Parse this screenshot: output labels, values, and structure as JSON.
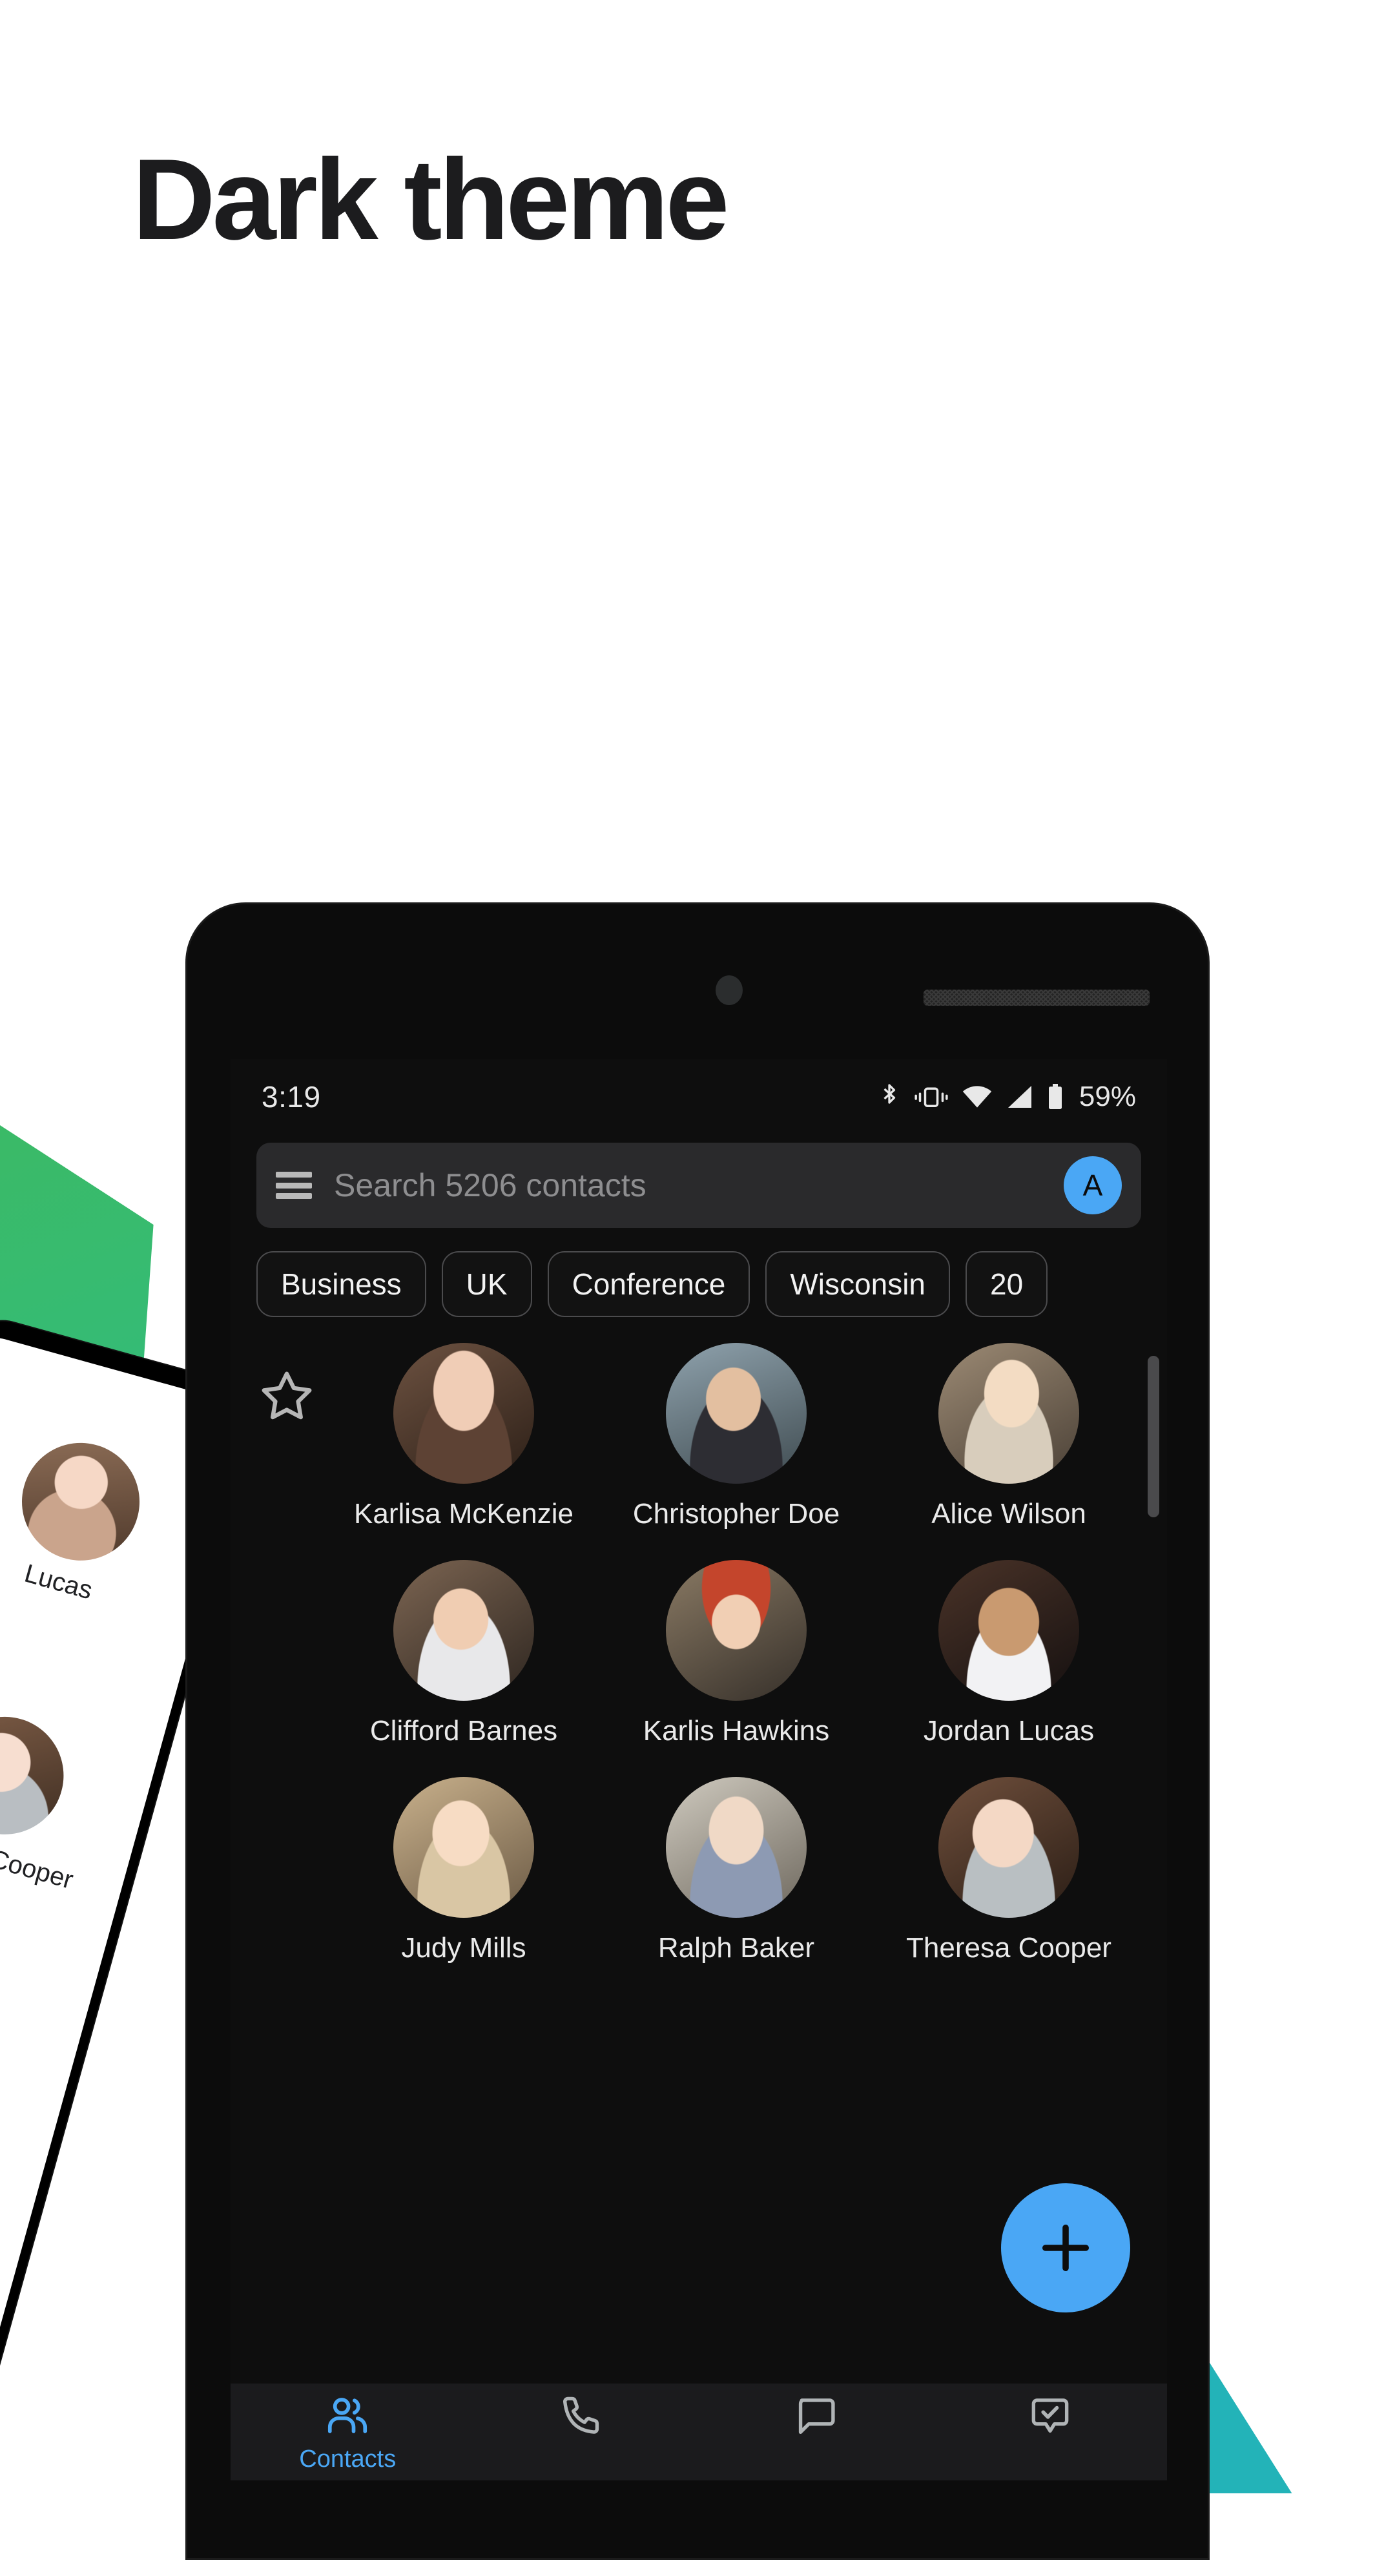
{
  "headline": "Dark theme",
  "phone": {
    "status_bar": {
      "time": "3:19",
      "battery_percent": "59%",
      "icons": [
        "bluetooth-icon",
        "vibrate-icon",
        "wifi-icon",
        "signal-icon",
        "battery-icon"
      ]
    },
    "search": {
      "menu_icon": "hamburger-menu-icon",
      "placeholder": "Search 5206 contacts",
      "account_avatar_letter": "A"
    },
    "chips": [
      {
        "label": "Business"
      },
      {
        "label": "UK"
      },
      {
        "label": "Conference"
      },
      {
        "label": "Wisconsin"
      },
      {
        "label": "20"
      }
    ],
    "favorites_star_icon": "star-outline-icon",
    "contacts": [
      {
        "name": "Karlisa McKenzie",
        "portrait": "p1"
      },
      {
        "name": "Christopher Doe",
        "portrait": "p2"
      },
      {
        "name": "Alice Wilson",
        "portrait": "p3"
      },
      {
        "name": "Clifford Barnes",
        "portrait": "p4"
      },
      {
        "name": "Karlis Hawkins",
        "portrait": "p5"
      },
      {
        "name": "Jordan Lucas",
        "portrait": "p6"
      },
      {
        "name": "Judy Mills",
        "portrait": "p7"
      },
      {
        "name": "Ralph Baker",
        "portrait": "p8"
      },
      {
        "name": "Theresa Cooper",
        "portrait": "p9"
      }
    ],
    "fab": {
      "icon": "plus-icon",
      "label": "Add contact"
    },
    "bottom_nav": [
      {
        "label": "Contacts",
        "icon": "people-icon",
        "active": true
      },
      {
        "label": "",
        "icon": "phone-icon",
        "active": false
      },
      {
        "label": "",
        "icon": "message-bubble-icon",
        "active": false
      },
      {
        "label": "",
        "icon": "bubble-check-icon",
        "active": false
      }
    ]
  },
  "back_phone": {
    "contacts": [
      {
        "name": "Lucas"
      },
      {
        "name": "Theresa Cooper"
      },
      {
        "name": ""
      }
    ]
  },
  "colors": {
    "accent_blue": "#4aa7f5",
    "screen_bg": "#0e0e0e",
    "searchbar_bg": "#2a2a2c",
    "nav_bg": "#1b1b1d",
    "deco_green": "#3cba63",
    "deco_teal": "#23b3b8",
    "headline": "#1c1c1e"
  }
}
